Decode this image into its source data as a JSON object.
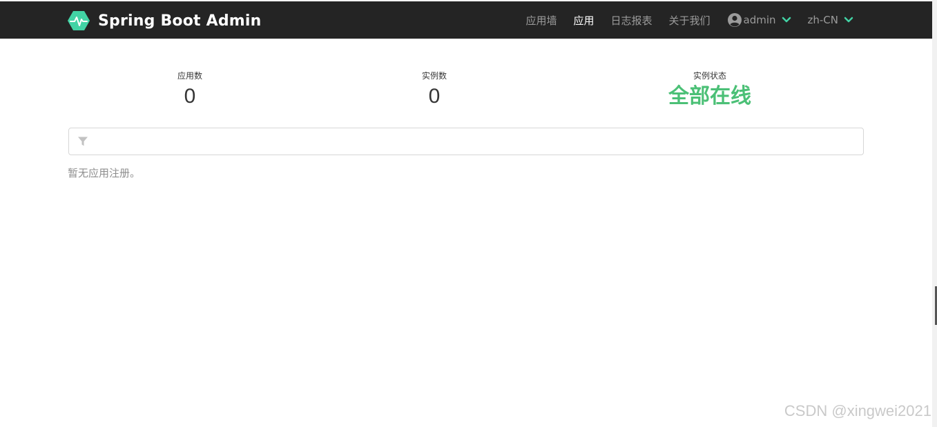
{
  "header": {
    "brand_title": "Spring Boot Admin",
    "logo_icon": "heartbeat-hexagon-icon",
    "nav": [
      {
        "label": "应用墙",
        "active": false
      },
      {
        "label": "应用",
        "active": true
      },
      {
        "label": "日志报表",
        "active": false
      },
      {
        "label": "关于我们",
        "active": false
      }
    ],
    "user_label": "admin",
    "language_label": "zh-CN"
  },
  "stats": {
    "apps_label": "应用数",
    "apps_value": "0",
    "instances_label": "实例数",
    "instances_value": "0",
    "status_label": "实例状态",
    "status_value": "全部在线"
  },
  "filter": {
    "placeholder": "",
    "value": ""
  },
  "empty_message": "暂无应用注册。",
  "watermark": "CSDN @xingwei2021",
  "colors": {
    "topbar_bg": "#242424",
    "accent": "#42d3a5",
    "status_green": "#4bc076"
  }
}
